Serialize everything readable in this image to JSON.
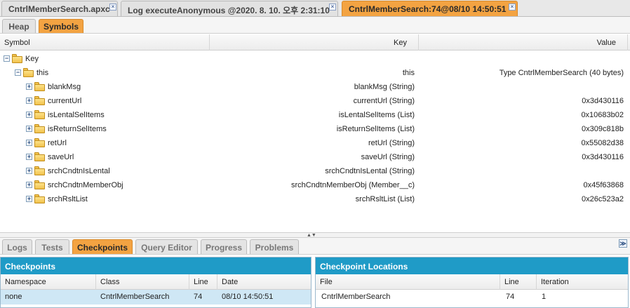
{
  "top_tabs": [
    {
      "label": "CntrlMemberSearch.apxc",
      "active": false
    },
    {
      "label": "Log executeAnonymous @2020. 8. 10. 오후 2:31:10",
      "active": false
    },
    {
      "label": "CntrlMemberSearch:74@08/10 14:50:51",
      "active": true
    }
  ],
  "sub_tabs": [
    {
      "label": "Heap",
      "active": false
    },
    {
      "label": "Symbols",
      "active": true
    }
  ],
  "symbol_table": {
    "headers": {
      "symbol": "Symbol",
      "key": "Key",
      "value": "Value"
    },
    "rows": [
      {
        "name": "Key",
        "key": "",
        "value": "",
        "expander": "−"
      },
      {
        "name": "this",
        "key": "this",
        "value": "Type CntrlMemberSearch (40 bytes)",
        "expander": "−"
      },
      {
        "name": "blankMsg",
        "key": "blankMsg (String)",
        "value": "",
        "expander": "+"
      },
      {
        "name": "currentUrl",
        "key": "currentUrl (String)",
        "value": "0x3d430116",
        "expander": "+"
      },
      {
        "name": "isLentalSelItems",
        "key": "isLentalSelItems (List)",
        "value": "0x10683b02",
        "expander": "+"
      },
      {
        "name": "isReturnSelItems",
        "key": "isReturnSelItems (List)",
        "value": "0x309c818b",
        "expander": "+"
      },
      {
        "name": "retUrl",
        "key": "retUrl (String)",
        "value": "0x55082d38",
        "expander": "+"
      },
      {
        "name": "saveUrl",
        "key": "saveUrl (String)",
        "value": "0x3d430116",
        "expander": "+"
      },
      {
        "name": "srchCndtnIsLental",
        "key": "srchCndtnIsLental (String)",
        "value": "",
        "expander": "+"
      },
      {
        "name": "srchCndtnMemberObj",
        "key": "srchCndtnMemberObj (Member__c)",
        "value": "0x45f63868",
        "expander": "+"
      },
      {
        "name": "srchRsltList",
        "key": "srchRsltList (List)",
        "value": "0x26c523a2",
        "expander": "+"
      }
    ]
  },
  "bottom_tabs": [
    {
      "label": "Logs",
      "active": false
    },
    {
      "label": "Tests",
      "active": false
    },
    {
      "label": "Checkpoints",
      "active": true
    },
    {
      "label": "Query Editor",
      "active": false
    },
    {
      "label": "Progress",
      "active": false
    },
    {
      "label": "Problems",
      "active": false
    }
  ],
  "collapse_icon": "≫",
  "checkpoints": {
    "title": "Checkpoints",
    "headers": {
      "namespace": "Namespace",
      "class": "Class",
      "line": "Line",
      "date": "Date"
    },
    "rows": [
      {
        "namespace": "none",
        "class": "CntrlMemberSearch",
        "line": "74",
        "date": "08/10 14:50:51"
      }
    ]
  },
  "checkpoint_locations": {
    "title": "Checkpoint Locations",
    "headers": {
      "file": "File",
      "line": "Line",
      "iteration": "Iteration"
    },
    "rows": [
      {
        "file": "CntrlMemberSearch",
        "line": "74",
        "iteration": "1"
      }
    ]
  }
}
